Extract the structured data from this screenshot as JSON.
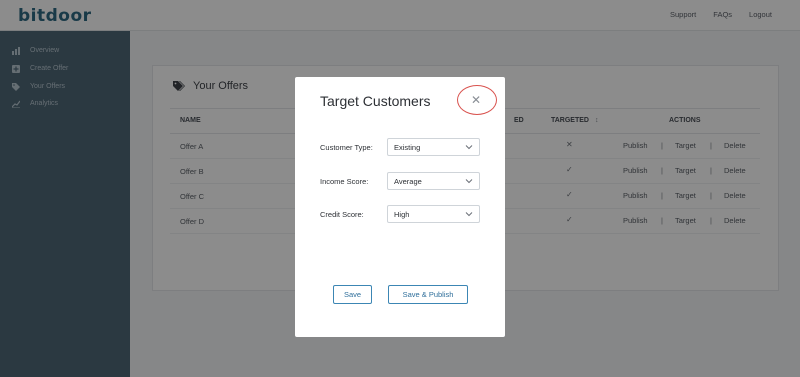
{
  "app": {
    "logo": "bitdoor"
  },
  "topnav": {
    "support": "Support",
    "faqs": "FAQs",
    "logout": "Logout"
  },
  "sidebar": {
    "items": [
      {
        "label": "Overview",
        "icon": "bar-chart-icon"
      },
      {
        "label": "Create Offer",
        "icon": "plus-square-icon"
      },
      {
        "label": "Your Offers",
        "icon": "tags-icon"
      },
      {
        "label": "Analytics",
        "icon": "line-chart-icon"
      }
    ]
  },
  "offers_card": {
    "title": "Your Offers",
    "columns": {
      "name": "NAME",
      "hidden_partial": "ED",
      "targeted": "TARGETED",
      "actions": "ACTIONS",
      "sort_glyph": "↕"
    },
    "rows": [
      {
        "name": "Offer A",
        "targeted": "✕",
        "publish": "Publish",
        "target": "Target",
        "delete": "Delete"
      },
      {
        "name": "Offer B",
        "targeted": "✓",
        "publish": "Publish",
        "target": "Target",
        "delete": "Delete"
      },
      {
        "name": "Offer C",
        "targeted": "✓",
        "publish": "Publish",
        "target": "Target",
        "delete": "Delete"
      },
      {
        "name": "Offer D",
        "targeted": "✓",
        "publish": "Publish",
        "target": "Target",
        "delete": "Delete"
      }
    ],
    "action_separator": "|"
  },
  "modal": {
    "title": "Target Customers",
    "close_glyph": "✕",
    "fields": [
      {
        "label": "Customer Type:",
        "value": "Existing"
      },
      {
        "label": "Income Score:",
        "value": "Average"
      },
      {
        "label": "Credit Score:",
        "value": "High"
      }
    ],
    "save_label": "Save",
    "save_publish_label": "Save & Publish"
  },
  "colors": {
    "brand": "#2f6a83",
    "sidebar": "#4f6877",
    "button_border": "#3c86b4",
    "highlight_ring": "#d9534f"
  }
}
